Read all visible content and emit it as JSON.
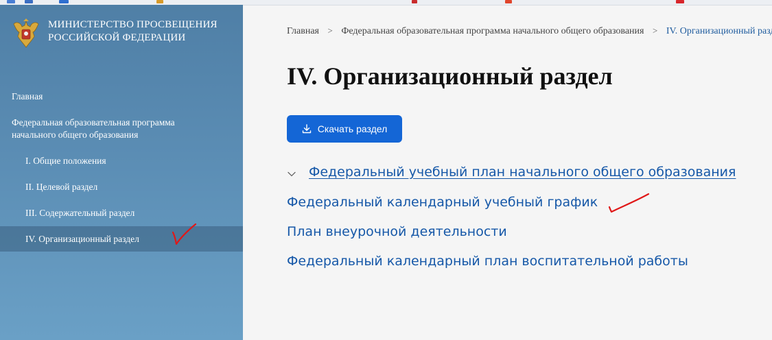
{
  "sidebar": {
    "ministry_line1": "МИНИСТЕРСТВО ПРОСВЕЩЕНИЯ",
    "ministry_line2": "РОССИЙСКОЙ ФЕДЕРАЦИИ",
    "items": [
      {
        "label": "Главная"
      },
      {
        "label": "Федеральная образовательная программа",
        "label2": "начального общего образования"
      },
      {
        "label": "I. Общие положения"
      },
      {
        "label": "II. Целевой раздел"
      },
      {
        "label": "III. Содержательный раздел"
      },
      {
        "label": "IV. Организационный раздел"
      }
    ]
  },
  "breadcrumb": {
    "home": "Главная",
    "parent": "Федеральная образовательная программа начального общего образования",
    "current": "IV. Организационный раздел"
  },
  "page": {
    "title": "IV. Организационный раздел",
    "download_label": "Скачать раздел",
    "links": [
      "Федеральный учебный план начального общего образования",
      "Федеральный календарный учебный график",
      "План внеурочной деятельности",
      "Федеральный календарный план воспитательной работы"
    ]
  },
  "colors": {
    "sidebar_top": "#4f7fa6",
    "sidebar_bottom": "#6aa0c6",
    "button": "#1466d6",
    "link": "#1658a8",
    "annotation": "#e01818"
  }
}
